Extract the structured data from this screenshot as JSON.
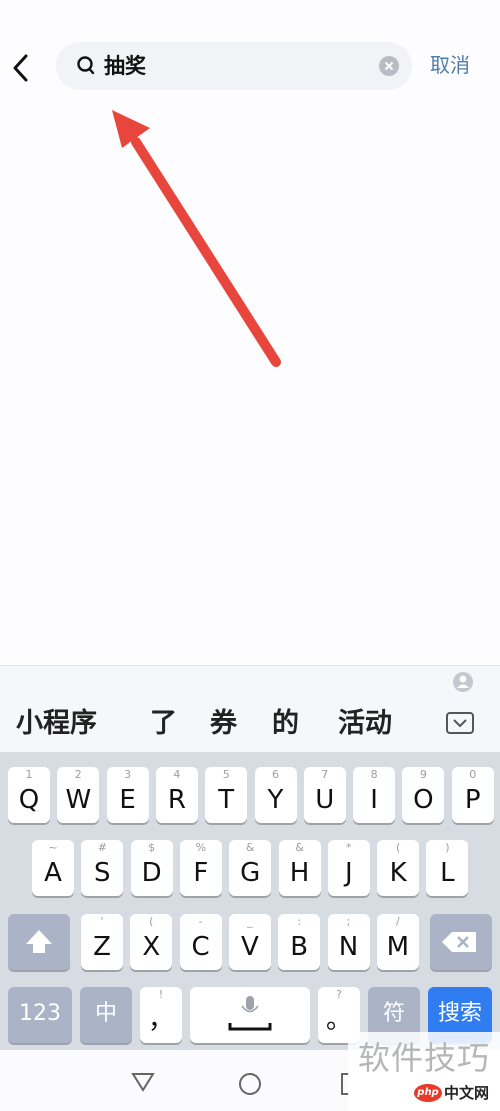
{
  "search": {
    "query": "抽奖",
    "cancel_label": "取消"
  },
  "candidates": [
    "小程序",
    "了",
    "券",
    "的",
    "活动"
  ],
  "keyboard": {
    "row1": [
      {
        "key": "Q",
        "hint": "1"
      },
      {
        "key": "W",
        "hint": "2"
      },
      {
        "key": "E",
        "hint": "3"
      },
      {
        "key": "R",
        "hint": "4"
      },
      {
        "key": "T",
        "hint": "5"
      },
      {
        "key": "Y",
        "hint": "6"
      },
      {
        "key": "U",
        "hint": "7"
      },
      {
        "key": "I",
        "hint": "8"
      },
      {
        "key": "O",
        "hint": "9"
      },
      {
        "key": "P",
        "hint": "0"
      }
    ],
    "row2": [
      {
        "key": "A",
        "hint": "~"
      },
      {
        "key": "S",
        "hint": "#"
      },
      {
        "key": "D",
        "hint": "$"
      },
      {
        "key": "F",
        "hint": "%"
      },
      {
        "key": "G",
        "hint": "&"
      },
      {
        "key": "H",
        "hint": "&"
      },
      {
        "key": "J",
        "hint": "*"
      },
      {
        "key": "K",
        "hint": "("
      },
      {
        "key": "L",
        "hint": ")"
      }
    ],
    "row3": [
      {
        "key": "Z",
        "hint": "'"
      },
      {
        "key": "X",
        "hint": "("
      },
      {
        "key": "C",
        "hint": "-"
      },
      {
        "key": "V",
        "hint": "_"
      },
      {
        "key": "B",
        "hint": ":"
      },
      {
        "key": "N",
        "hint": ";"
      },
      {
        "key": "M",
        "hint": "/"
      }
    ],
    "num_label": "123",
    "lang_label": "中",
    "comma_key": "，",
    "comma_hint": "!",
    "period_key": "。",
    "period_hint": "?",
    "symbol_label": "符",
    "search_label": "搜索"
  },
  "watermark": {
    "text": "软件技巧",
    "php_badge": "php",
    "php_site": "中文网"
  },
  "colors": {
    "accent": "#2f7df1",
    "cancel": "#4f7daa",
    "arrow": "#e8453c"
  }
}
